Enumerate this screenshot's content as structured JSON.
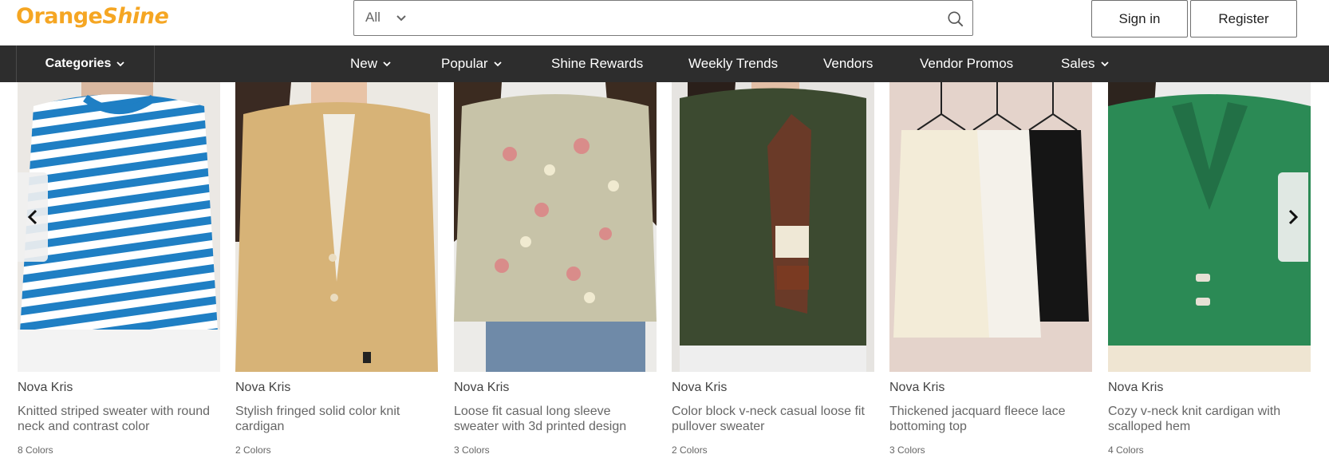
{
  "header": {
    "logo_part1": "Orange",
    "logo_part2": "Shine",
    "search_scope": "All",
    "search_placeholder": "",
    "sign_in": "Sign in",
    "register": "Register"
  },
  "nav": {
    "categories": "Categories",
    "items": [
      "New",
      "Popular",
      "Shine Rewards",
      "Weekly Trends",
      "Vendors",
      "Vendor Promos",
      "Sales"
    ]
  },
  "products": [
    {
      "brand": "Nova Kris",
      "name": "Knitted striped sweater with round neck and contrast color",
      "colors": "8 Colors"
    },
    {
      "brand": "Nova Kris",
      "name": "Stylish fringed solid color knit cardigan",
      "colors": "2 Colors"
    },
    {
      "brand": "Nova Kris",
      "name": "Loose fit casual long sleeve sweater with 3d printed design",
      "colors": "3 Colors"
    },
    {
      "brand": "Nova Kris",
      "name": "Color block v-neck casual loose fit pullover sweater",
      "colors": "2 Colors"
    },
    {
      "brand": "Nova Kris",
      "name": "Thickened jacquard fleece lace bottoming top",
      "colors": "3 Colors"
    },
    {
      "brand": "Nova Kris",
      "name": "Cozy v-neck knit cardigan with scalloped hem",
      "colors": "4 Colors"
    }
  ],
  "colors": {
    "brand_orange": "#f5a623",
    "nav_bg": "#2d2d2d"
  },
  "icons": {
    "search": "search-icon",
    "dropdown": "chevron-down-icon",
    "prev": "chevron-left-icon",
    "next": "chevron-right-icon"
  }
}
